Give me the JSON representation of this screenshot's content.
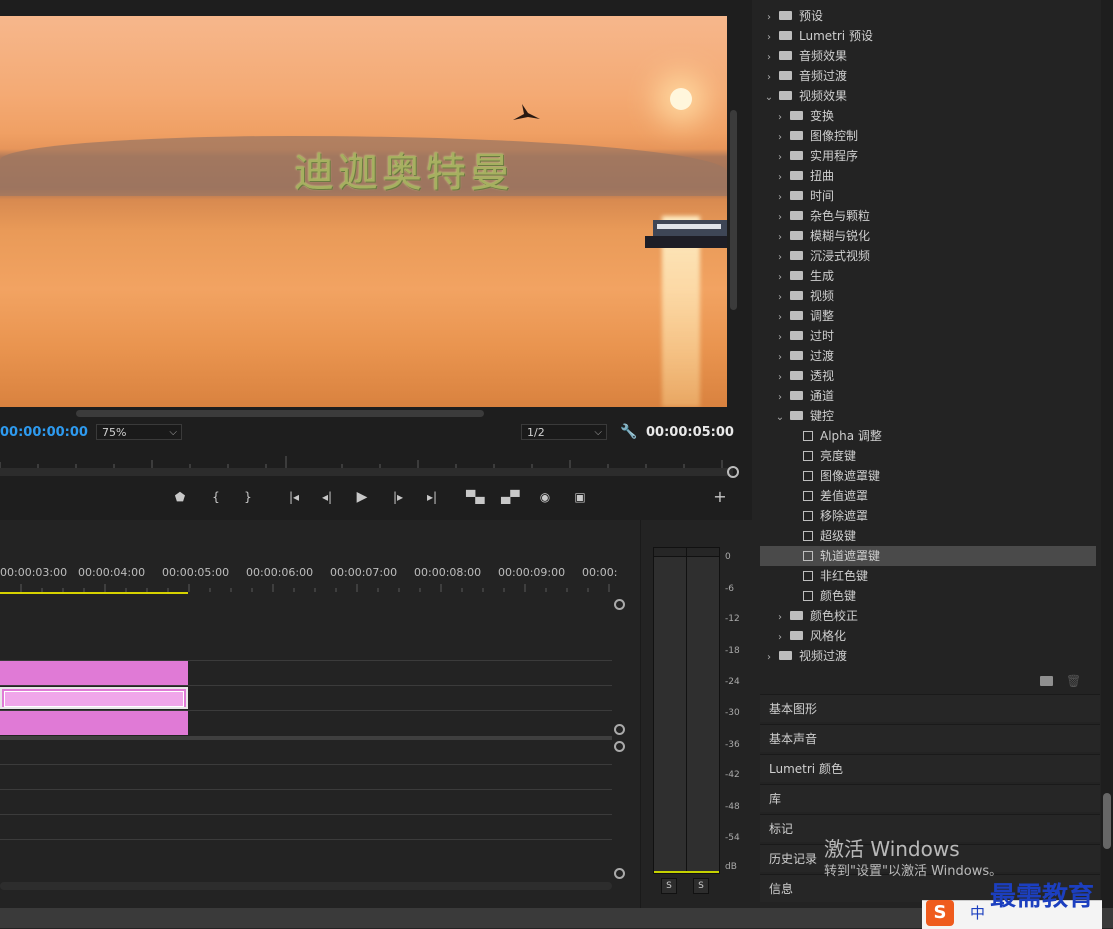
{
  "monitor": {
    "title_overlay": "迪迦奥特曼",
    "timecode_current": "00:00:00:00",
    "timecode_duration": "00:00:05:00",
    "zoom": "75%",
    "resolution": "1/2",
    "transport_icons": [
      "marker-icon",
      "mark-in-icon",
      "mark-out-icon",
      "go-to-in-icon",
      "step-back-icon",
      "play-icon",
      "step-forward-icon",
      "go-to-out-icon",
      "lift-icon",
      "extract-icon",
      "export-frame-icon",
      "compare-icon",
      "add-button-icon"
    ]
  },
  "timeline": {
    "ticks": [
      "00:00:03:00",
      "00:00:04:00",
      "00:00:05:00",
      "00:00:06:00",
      "00:00:07:00",
      "00:00:08:00",
      "00:00:09:00",
      "00:00:"
    ]
  },
  "meter": {
    "labels": [
      "0",
      "-6",
      "-12",
      "-18",
      "-24",
      "-30",
      "-36",
      "-42",
      "-48",
      "-54",
      "dB"
    ],
    "solo_left": "S",
    "solo_right": "S"
  },
  "effects": {
    "items": [
      {
        "label": "预设",
        "level": 0,
        "expanded": false,
        "type": "preset"
      },
      {
        "label": "Lumetri 预设",
        "level": 0,
        "expanded": false,
        "type": "preset"
      },
      {
        "label": "音频效果",
        "level": 0,
        "expanded": false,
        "type": "folder"
      },
      {
        "label": "音频过渡",
        "level": 0,
        "expanded": false,
        "type": "folder"
      },
      {
        "label": "视频效果",
        "level": 0,
        "expanded": true,
        "type": "folder"
      },
      {
        "label": "变换",
        "level": 1,
        "expanded": false,
        "type": "folder"
      },
      {
        "label": "图像控制",
        "level": 1,
        "expanded": false,
        "type": "folder"
      },
      {
        "label": "实用程序",
        "level": 1,
        "expanded": false,
        "type": "folder"
      },
      {
        "label": "扭曲",
        "level": 1,
        "expanded": false,
        "type": "folder"
      },
      {
        "label": "时间",
        "level": 1,
        "expanded": false,
        "type": "folder"
      },
      {
        "label": "杂色与颗粒",
        "level": 1,
        "expanded": false,
        "type": "folder"
      },
      {
        "label": "模糊与锐化",
        "level": 1,
        "expanded": false,
        "type": "folder"
      },
      {
        "label": "沉浸式视频",
        "level": 1,
        "expanded": false,
        "type": "folder"
      },
      {
        "label": "生成",
        "level": 1,
        "expanded": false,
        "type": "folder"
      },
      {
        "label": "视频",
        "level": 1,
        "expanded": false,
        "type": "folder"
      },
      {
        "label": "调整",
        "level": 1,
        "expanded": false,
        "type": "folder"
      },
      {
        "label": "过时",
        "level": 1,
        "expanded": false,
        "type": "folder"
      },
      {
        "label": "过渡",
        "level": 1,
        "expanded": false,
        "type": "folder"
      },
      {
        "label": "透视",
        "level": 1,
        "expanded": false,
        "type": "folder"
      },
      {
        "label": "通道",
        "level": 1,
        "expanded": false,
        "type": "folder"
      },
      {
        "label": "键控",
        "level": 1,
        "expanded": true,
        "type": "folder"
      },
      {
        "label": "Alpha 调整",
        "level": 2,
        "type": "effect"
      },
      {
        "label": "亮度键",
        "level": 2,
        "type": "effect"
      },
      {
        "label": "图像遮罩键",
        "level": 2,
        "type": "effect"
      },
      {
        "label": "差值遮罩",
        "level": 2,
        "type": "effect"
      },
      {
        "label": "移除遮罩",
        "level": 2,
        "type": "effect"
      },
      {
        "label": "超级键",
        "level": 2,
        "type": "effect"
      },
      {
        "label": "轨道遮罩键",
        "level": 2,
        "type": "effect",
        "selected": true
      },
      {
        "label": "非红色键",
        "level": 2,
        "type": "effect"
      },
      {
        "label": "颜色键",
        "level": 2,
        "type": "effect"
      },
      {
        "label": "颜色校正",
        "level": 1,
        "expanded": false,
        "type": "folder"
      },
      {
        "label": "风格化",
        "level": 1,
        "expanded": false,
        "type": "folder"
      },
      {
        "label": "视频过渡",
        "level": 0,
        "expanded": false,
        "type": "folder"
      }
    ]
  },
  "panels": [
    "基本图形",
    "基本声音",
    "Lumetri 颜色",
    "库",
    "标记",
    "历史记录",
    "信息"
  ],
  "os": {
    "activate_title": "激活 Windows",
    "activate_sub": "转到\"设置\"以激活 Windows。",
    "brand": "最需教育",
    "ime_logo": "S",
    "ime_lang": "中"
  },
  "colors": {
    "clip": "#e07ad6",
    "timecode": "#2e9bf0",
    "workarea": "#d6d200"
  }
}
